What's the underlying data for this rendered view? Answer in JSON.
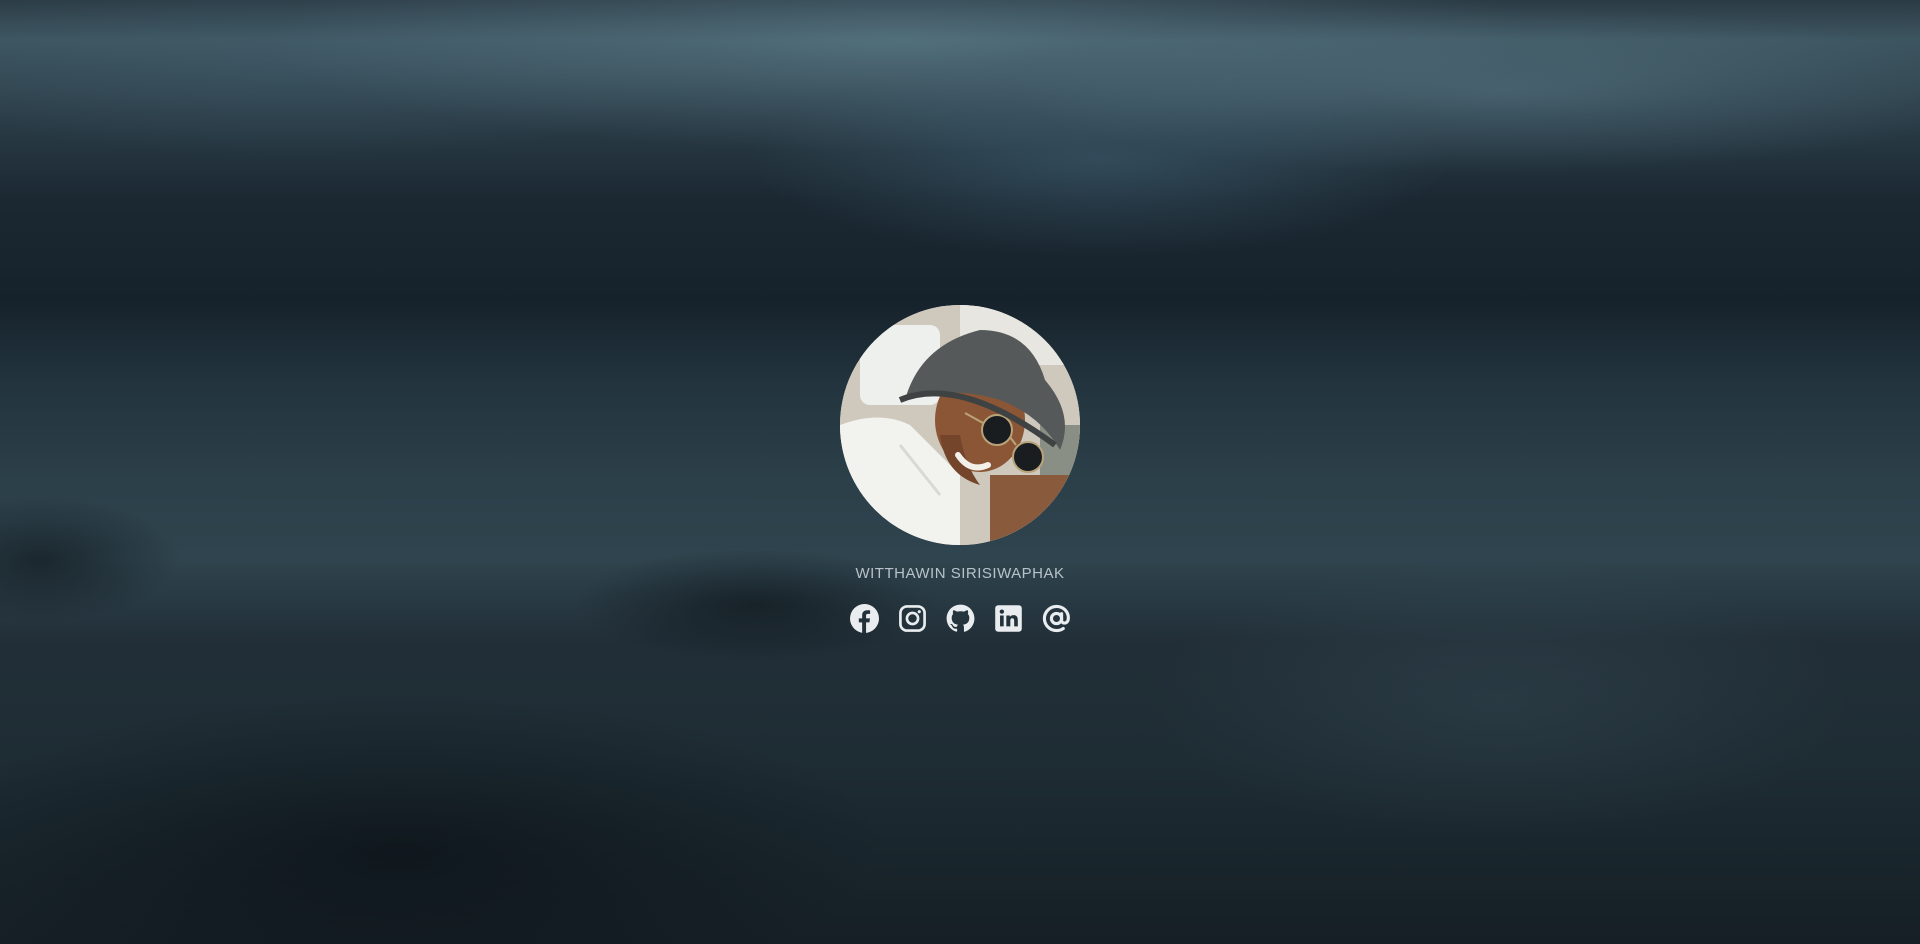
{
  "profile": {
    "name": "WITTHAWIN SIRISIWAPHAK",
    "avatar_icon": "profile-photo"
  },
  "socials": [
    {
      "icon": "facebook-icon"
    },
    {
      "icon": "instagram-icon"
    },
    {
      "icon": "github-icon"
    },
    {
      "icon": "linkedin-icon"
    },
    {
      "icon": "at-sign-icon"
    }
  ],
  "colors": {
    "icon": "#e9edef",
    "name_text": "#b8c2c8"
  }
}
